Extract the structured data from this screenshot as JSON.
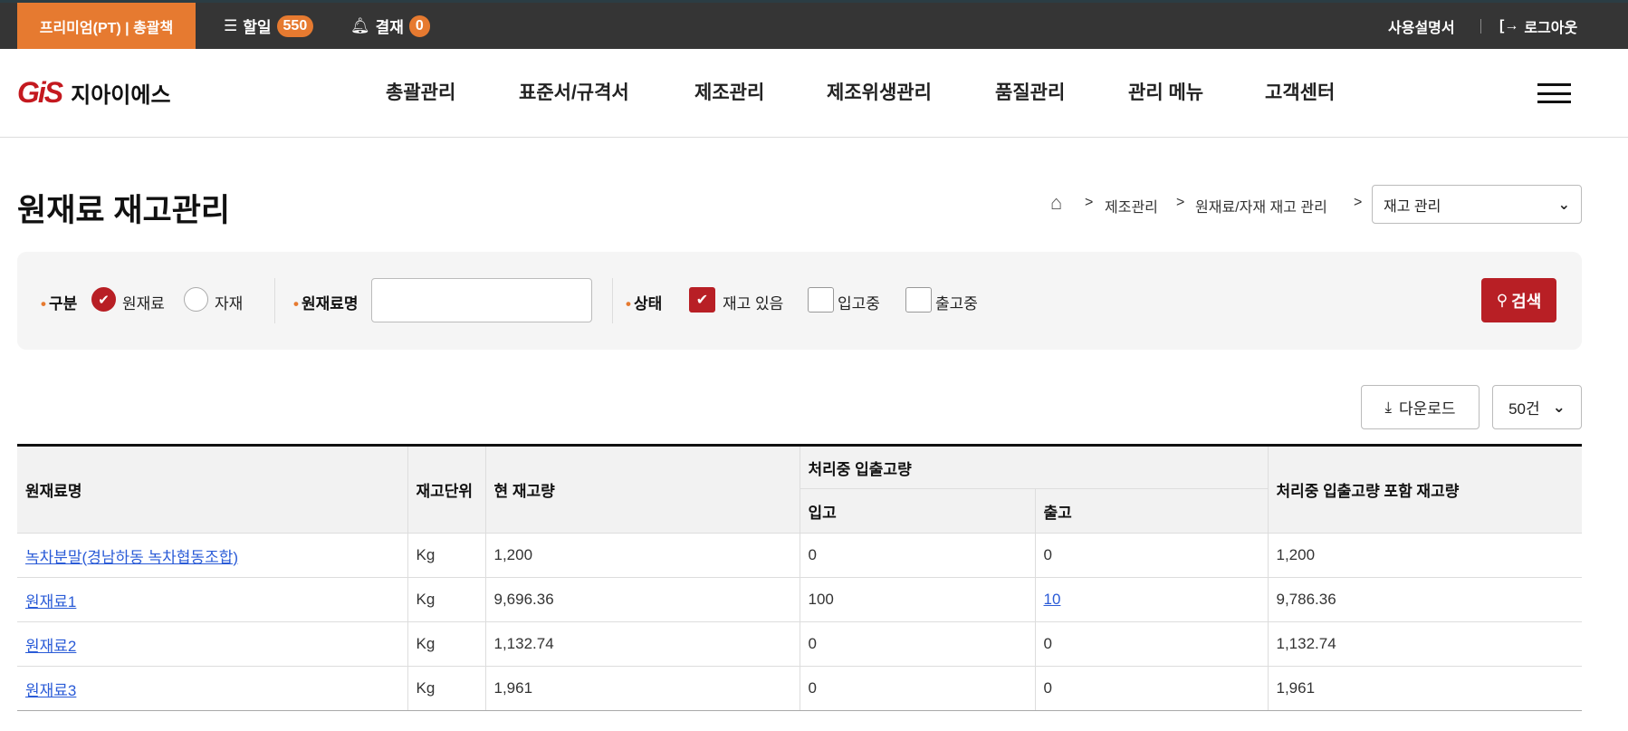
{
  "topbar": {
    "plan_label": "프리미엄(PT) | 총괄책",
    "todo_label": "할일",
    "todo_count": "550",
    "approval_label": "결재",
    "approval_count": "0",
    "manual_label": "사용설명서",
    "logout_label": "로그아웃"
  },
  "header": {
    "logo_mark": "GiS",
    "logo_text": "지아이에스",
    "nav": [
      "총괄관리",
      "표준서/규격서",
      "제조관리",
      "제조위생관리",
      "품질관리",
      "관리 메뉴",
      "고객센터"
    ]
  },
  "page": {
    "title": "원재료 재고관리",
    "breadcrumb": [
      "제조관리",
      "원재료/자재 재고 관리"
    ],
    "breadcrumb_select": "재고 관리"
  },
  "filter": {
    "type_label": "구분",
    "type_options": [
      {
        "label": "원재료",
        "checked": true
      },
      {
        "label": "자재",
        "checked": false
      }
    ],
    "name_label": "원재료명",
    "name_value": "",
    "status_label": "상태",
    "status_options": [
      {
        "label": "재고 있음",
        "checked": true
      },
      {
        "label": "입고중",
        "checked": false
      },
      {
        "label": "출고중",
        "checked": false
      }
    ],
    "search_label": "검색"
  },
  "toolbar": {
    "download_label": "다운로드",
    "page_size": "50건"
  },
  "table": {
    "headers": {
      "name": "원재료명",
      "unit": "재고단위",
      "current": "현 재고량",
      "processing": "처리중 입출고량",
      "in": "입고",
      "out": "출고",
      "total": "처리중 입출고량 포함 재고량"
    },
    "rows": [
      {
        "name": "녹차분말(경남하동 녹차협동조합)",
        "unit": "Kg",
        "current": "1,200",
        "in": "0",
        "out": "0",
        "total": "1,200"
      },
      {
        "name": "원재료1",
        "unit": "Kg",
        "current": "9,696.36",
        "in": "100",
        "out": "10",
        "total": "9,786.36"
      },
      {
        "name": "원재료2",
        "unit": "Kg",
        "current": "1,132.74",
        "in": "0",
        "out": "0",
        "total": "1,132.74"
      },
      {
        "name": "원재료3",
        "unit": "Kg",
        "current": "1,961",
        "in": "0",
        "out": "0",
        "total": "1,961"
      }
    ]
  }
}
